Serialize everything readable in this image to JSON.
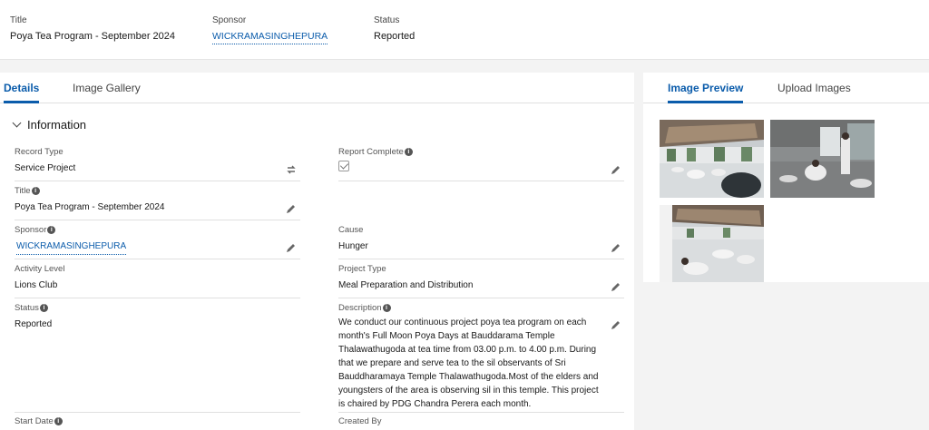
{
  "header": {
    "title_label": "Title",
    "title_value": "Poya Tea Program - September 2024",
    "sponsor_label": "Sponsor",
    "sponsor_value": "WICKRAMASINGHEPURA",
    "status_label": "Status",
    "status_value": "Reported"
  },
  "left_tabs": [
    {
      "label": "Details",
      "active": true
    },
    {
      "label": "Image Gallery",
      "active": false
    }
  ],
  "section": {
    "label": "Information"
  },
  "fields": {
    "record_type": {
      "label": "Record Type",
      "value": "Service Project"
    },
    "report_complete": {
      "label": "Report Complete",
      "checked": true
    },
    "title": {
      "label": "Title",
      "value": "Poya Tea Program - September 2024"
    },
    "sponsor": {
      "label": "Sponsor",
      "value": "WICKRAMASINGHEPURA"
    },
    "cause": {
      "label": "Cause",
      "value": "Hunger"
    },
    "activity_level": {
      "label": "Activity Level",
      "value": "Lions Club"
    },
    "project_type": {
      "label": "Project Type",
      "value": "Meal Preparation and Distribution"
    },
    "status": {
      "label": "Status",
      "value": "Reported"
    },
    "description": {
      "label": "Description",
      "value": "We conduct our continuous project poya tea program on each month's Full Moon Poya Days at Bauddarama Temple Thalawathugoda at tea time from 03.00 p.m. to 4.00 p.m. During that we prepare and serve tea to the sil observants of Sri Bauddharamaya Temple Thalawathugoda.Most of the elders and youngsters of the area is observing sil in this temple. This project is chaired by PDG Chandra Perera each month."
    },
    "start_date": {
      "label": "Start Date"
    },
    "created_by": {
      "label": "Created By"
    }
  },
  "right_tabs": [
    {
      "label": "Image Preview",
      "active": true
    },
    {
      "label": "Upload Images",
      "active": false
    }
  ],
  "info_glyph": "i",
  "colors": {
    "accent": "#0b5cab",
    "text": "#181818",
    "label": "#555555",
    "background": "#f3f3f3"
  },
  "icons": [
    "pencil-icon",
    "swap-icon",
    "info-icon",
    "chevron-down-icon",
    "checkbox-icon"
  ]
}
